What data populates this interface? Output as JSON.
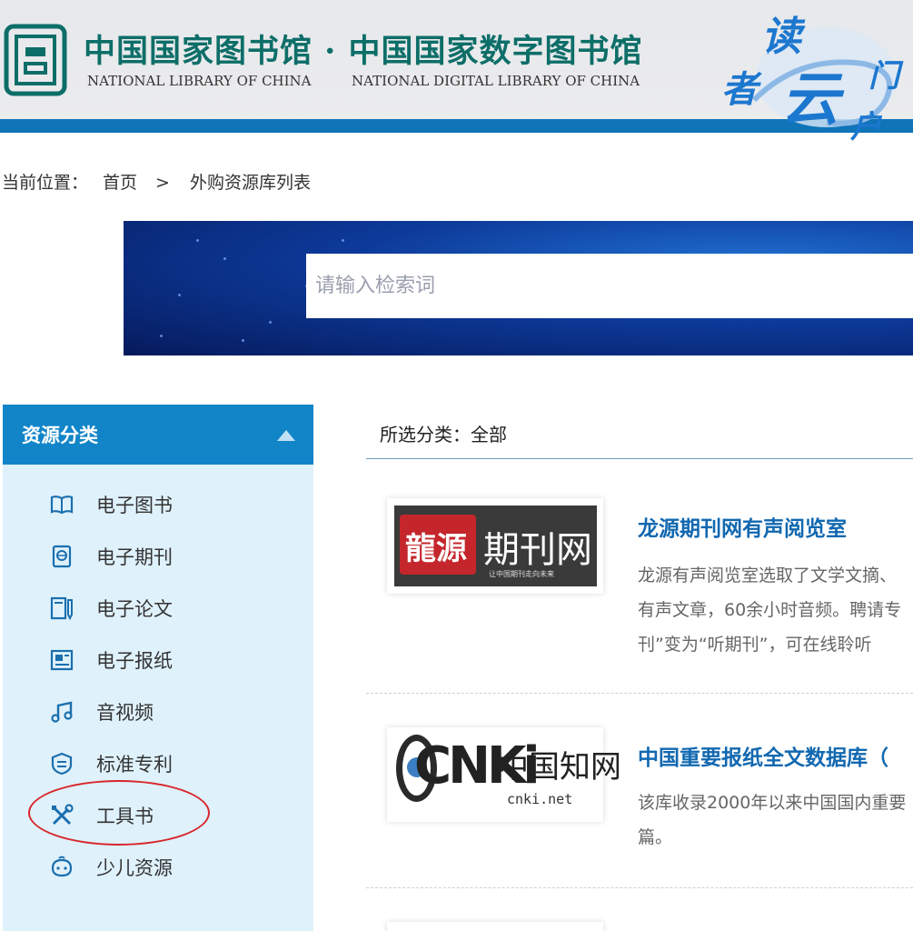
{
  "header": {
    "title_cn": "中国国家图书馆 · 中国国家数字图书馆",
    "title_en_1": "NATIONAL LIBRARY OF CHINA",
    "title_en_2": "NATIONAL DIGITAL LIBRARY OF CHINA",
    "deco_chars": [
      "读",
      "者",
      "云",
      "门",
      "户"
    ],
    "colors": {
      "brand": "#0d6e68",
      "stripe": "#0f74b8"
    }
  },
  "breadcrumb": {
    "prefix": "当前位置：",
    "home": "首页",
    "separator": ">",
    "current": "外购资源库列表"
  },
  "search": {
    "placeholder": "请输入检索词"
  },
  "sidebar": {
    "title": "资源分类",
    "items": [
      {
        "label": "电子图书",
        "icon": "book-icon"
      },
      {
        "label": "电子期刊",
        "icon": "journal-icon"
      },
      {
        "label": "电子论文",
        "icon": "thesis-icon"
      },
      {
        "label": "电子报纸",
        "icon": "newspaper-icon"
      },
      {
        "label": "音视频",
        "icon": "music-icon"
      },
      {
        "label": "标准专利",
        "icon": "patent-icon"
      },
      {
        "label": "工具书",
        "icon": "tools-icon"
      },
      {
        "label": "少儿资源",
        "icon": "child-icon"
      }
    ]
  },
  "main": {
    "selected_category": "所选分类：全部",
    "items": [
      {
        "title": "龙源期刊网有声阅览室",
        "logo_text_1": "龍源",
        "logo_text_2": "期刊网",
        "logo_sub": "让中国期刊走向未来",
        "desc_lines": [
          "龙源有声阅览室选取了文学文摘、",
          "有声文章，60余小时音频。聘请专",
          "刊”变为“听期刊”，可在线聆听"
        ]
      },
      {
        "title": "中国重要报纸全文数据库（",
        "logo_text_1": "CNKi",
        "logo_text_2": "中国知网",
        "logo_sub": "cnki.net",
        "desc_lines": [
          "该库收录2000年以来中国国内重要",
          "篇。"
        ]
      }
    ]
  }
}
